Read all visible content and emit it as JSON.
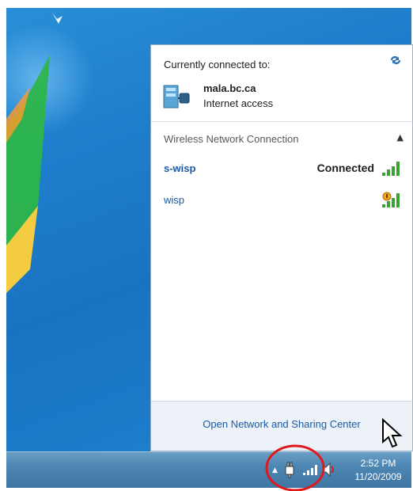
{
  "flyout": {
    "connected_label": "Currently connected to:",
    "refresh_icon": "refresh-icon",
    "current_network": {
      "name": "mala.bc.ca",
      "status": "Internet access",
      "icon": "network-icon"
    },
    "section_label": "Wireless Network Connection",
    "collapse_icon": "chevron-up-icon",
    "networks": [
      {
        "ssid": "s-wisp",
        "state": "Connected",
        "secured": false
      },
      {
        "ssid": "wisp",
        "state": "",
        "secured": true
      }
    ],
    "footer_link": "Open Network and Sharing Center"
  },
  "taskbar": {
    "time": "2:52 PM",
    "date": "11/20/2009",
    "tray_icons": [
      "show-hidden-icons-arrow",
      "power-icon",
      "wireless-signal-icon",
      "volume-icon"
    ]
  },
  "colors": {
    "link": "#1b5aa6",
    "highlight_ring": "#e0181b",
    "desktop": "#1f7fcd"
  }
}
